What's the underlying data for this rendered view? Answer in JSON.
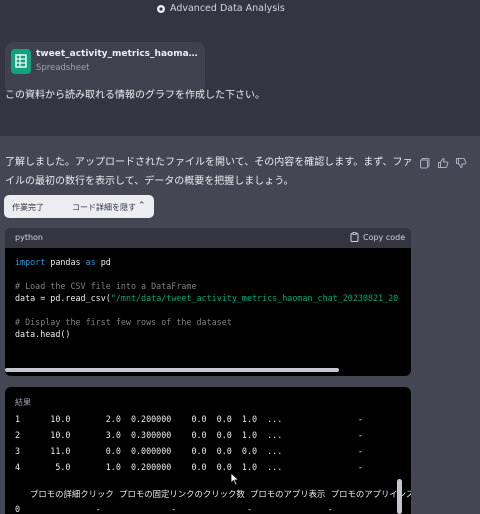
{
  "header": {
    "title": "Advanced Data Analysis",
    "icon": "spark-icon"
  },
  "attachment": {
    "file_name": "tweet_activity_metrics_haoman_chat_2023…",
    "file_type": "Spreadsheet",
    "icon": "spreadsheet-icon",
    "icon_color": "#10a37f"
  },
  "user_message": "この資料から読み取れる情報のグラフを作成した下さい。",
  "assistant": {
    "line1": "了解しました。アップロードされたファイルを開いて、その内容を確認します。まず、ファ",
    "line2": "イルの最初の数行を表示して、データの概要を把握しましょう。",
    "status_done": "作業完了",
    "status_toggle": "コード詳細を隠す"
  },
  "code": {
    "language": "python",
    "copy_label": "Copy code",
    "line1_kw1": "import",
    "line1_mid": " pandas ",
    "line1_kw2": "as",
    "line1_end": " pd",
    "line2": "# Load the CSV file into a DataFrame",
    "line3_pre": "data = pd.read_csv(",
    "line3_str": "\"/mnt/data/tweet_activity_metrics_haoman_chat_20230821_20",
    "line4": "# Display the first few rows of the dataset",
    "line5": "data.head()"
  },
  "result": {
    "label": "結果",
    "rows": [
      "1      10.0       2.0  0.200000    0.0  0.0  1.0  ...               -",
      "2      10.0       3.0  0.300000    0.0  0.0  1.0  ...               -",
      "3      11.0       0.0  0.000000    0.0  0.0  0.0  ...               -",
      "4       5.0       1.0  0.200000    0.0  0.0  1.0  ...               -"
    ],
    "header_row": "プロモの詳細クリック  プロモの固定リンクのクリック数  プロモのアプリ表示  プロモのアプリインス",
    "row0": "0               -              -              -               -"
  }
}
